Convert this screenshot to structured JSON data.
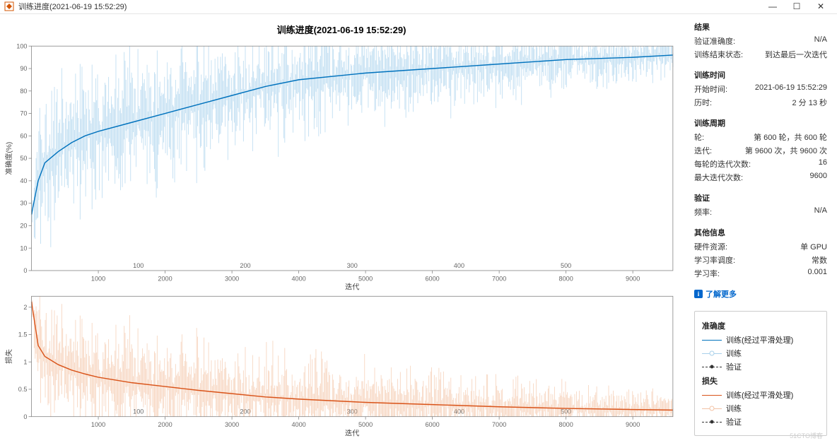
{
  "window": {
    "title": "训练进度(2021-06-19 15:52:29)",
    "min_btn": "—",
    "max_btn": "☐",
    "close_btn": "✕"
  },
  "chart_title": "训练进度(2021-06-19 15:52:29)",
  "chart_data": [
    {
      "type": "line",
      "title": "准确度(%)",
      "xlabel": "迭代",
      "ylabel": "准确度(%)",
      "xlim": [
        0,
        9600
      ],
      "ylim": [
        0,
        100
      ],
      "x_ticks": [
        1000,
        2000,
        3000,
        4000,
        5000,
        6000,
        7000,
        8000,
        9000
      ],
      "epoch_ticks": [
        100,
        200,
        300,
        400,
        500
      ],
      "y_ticks": [
        0,
        10,
        20,
        30,
        40,
        50,
        60,
        70,
        80,
        90,
        100
      ],
      "raw_accuracy_range": [
        5,
        100
      ],
      "series": [
        {
          "name": "训练(经过平滑处理)",
          "color": "#0072bd",
          "x": [
            0,
            100,
            200,
            400,
            600,
            800,
            1000,
            1500,
            2000,
            2500,
            3000,
            3500,
            4000,
            5000,
            6000,
            7000,
            8000,
            9000,
            9600
          ],
          "values": [
            25,
            40,
            48,
            53,
            57,
            60,
            62,
            66,
            70,
            74,
            78,
            82,
            85,
            88,
            90,
            92,
            94,
            95,
            96
          ]
        },
        {
          "name": "训练(原始)",
          "color": "#a8d0eb",
          "note": "highly noisy ±15–35 around smoothed"
        },
        {
          "name": "验证",
          "color": "#333333",
          "values": "N/A"
        }
      ]
    },
    {
      "type": "line",
      "title": "损失",
      "xlabel": "迭代",
      "ylabel": "损失",
      "xlim": [
        0,
        9600
      ],
      "ylim": [
        0,
        2.2
      ],
      "x_ticks": [
        1000,
        2000,
        3000,
        4000,
        5000,
        6000,
        7000,
        8000,
        9000
      ],
      "epoch_ticks": [
        100,
        200,
        300,
        400,
        500
      ],
      "y_ticks": [
        0,
        0.5,
        1,
        1.5,
        2
      ],
      "raw_loss_range": [
        0,
        2.2
      ],
      "series": [
        {
          "name": "训练(经过平滑处理)",
          "color": "#d95319",
          "x": [
            0,
            100,
            200,
            400,
            600,
            800,
            1000,
            1500,
            2000,
            2500,
            3000,
            3500,
            4000,
            5000,
            6000,
            7000,
            8000,
            9000,
            9600
          ],
          "values": [
            2.1,
            1.3,
            1.1,
            0.95,
            0.85,
            0.78,
            0.72,
            0.62,
            0.55,
            0.48,
            0.42,
            0.36,
            0.32,
            0.26,
            0.22,
            0.18,
            0.15,
            0.13,
            0.12
          ]
        },
        {
          "name": "训练(原始)",
          "color": "#f3c3a5",
          "note": "highly noisy ±0.3–0.8 around smoothed"
        },
        {
          "name": "验证",
          "color": "#333333",
          "values": "N/A"
        }
      ]
    }
  ],
  "results": {
    "title": "结果",
    "val_acc_label": "验证准确度:",
    "val_acc": "N/A",
    "status_label": "训练结束状态:",
    "status": "到达最后一次迭代"
  },
  "timing": {
    "title": "训练时间",
    "start_label": "开始时间:",
    "start": "2021-06-19 15:52:29",
    "elapsed_label": "历时:",
    "elapsed": "2 分 13 秒"
  },
  "schedule": {
    "title": "训练周期",
    "epoch_label": "轮:",
    "epoch": "第 600 轮，共 600 轮",
    "iter_label": "迭代:",
    "iter": "第 9600 次，共 9600 次",
    "per_epoch_label": "每轮的迭代次数:",
    "per_epoch": "16",
    "max_iter_label": "最大迭代次数:",
    "max_iter": "9600"
  },
  "validation": {
    "title": "验证",
    "freq_label": "频率:",
    "freq": "N/A"
  },
  "other": {
    "title": "其他信息",
    "hw_label": "硬件资源:",
    "hw": "单 GPU",
    "lr_sched_label": "学习率调度:",
    "lr_sched": "常数",
    "lr_label": "学习率:",
    "lr": "0.001"
  },
  "learn_more": "了解更多",
  "legend": {
    "acc_title": "准确度",
    "loss_title": "损失",
    "train_smooth": "训练(经过平滑处理)",
    "train_raw": "训练",
    "validation": "验证"
  },
  "watermark": "51CTO博客"
}
